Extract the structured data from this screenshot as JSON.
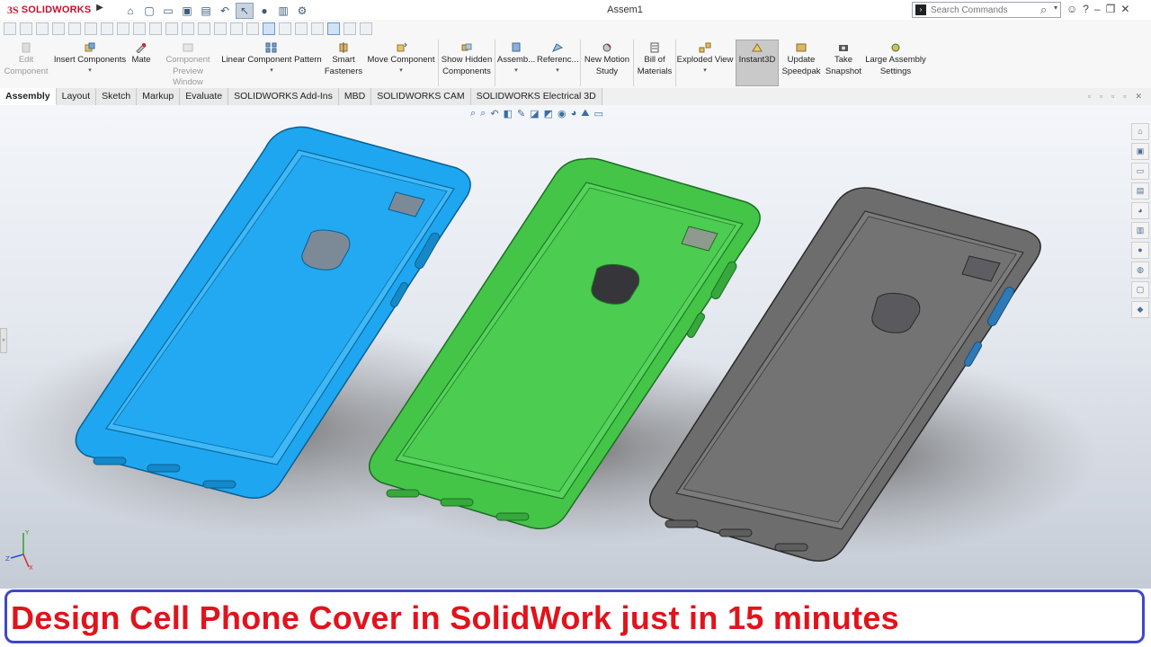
{
  "app": {
    "logo_mark": "3S",
    "logo_text": "SOLIDWORKS",
    "document_title": "Assem1"
  },
  "search": {
    "placeholder": "Search Commands"
  },
  "quick_access_icons": [
    "home-icon",
    "new-document-icon",
    "open-icon",
    "save-icon",
    "print-icon",
    "undo-icon",
    "select-icon",
    "rebuild-icon",
    "file-properties-icon",
    "options-icon"
  ],
  "command_manager": {
    "buttons": [
      {
        "label_1": "Edit",
        "label_2": "Component",
        "enabled": false
      },
      {
        "label_1": "Insert Components",
        "label_2": "",
        "dropdown": true
      },
      {
        "label_1": "Mate",
        "label_2": ""
      },
      {
        "label_1": "Component",
        "label_2": "Preview Window",
        "enabled": false
      },
      {
        "label_1": "Linear Component Pattern",
        "label_2": "",
        "dropdown": true
      },
      {
        "label_1": "Smart",
        "label_2": "Fasteners"
      },
      {
        "label_1": "Move Component",
        "label_2": "",
        "dropdown": true
      },
      {
        "label_1": "Show Hidden",
        "label_2": "Components"
      },
      {
        "label_1": "Assemb...",
        "label_2": "",
        "dropdown": true
      },
      {
        "label_1": "Referenc...",
        "label_2": "",
        "dropdown": true
      },
      {
        "label_1": "New Motion",
        "label_2": "Study"
      },
      {
        "label_1": "Bill of",
        "label_2": "Materials"
      },
      {
        "label_1": "Exploded View",
        "label_2": "",
        "dropdown": true
      },
      {
        "label_1": "Instant3D",
        "label_2": "",
        "active": true
      },
      {
        "label_1": "Update",
        "label_2": "Speedpak"
      },
      {
        "label_1": "Take",
        "label_2": "Snapshot"
      },
      {
        "label_1": "Large Assembly",
        "label_2": "Settings"
      }
    ]
  },
  "tabs": [
    "Assembly",
    "Layout",
    "Sketch",
    "Markup",
    "Evaluate",
    "SOLIDWORKS Add-Ins",
    "MBD",
    "SOLIDWORKS CAM",
    "SOLIDWORKS Electrical 3D"
  ],
  "active_tab": "Assembly",
  "viewport": {
    "models": [
      {
        "name": "blue-phone-cover",
        "color": "#1ea7f0"
      },
      {
        "name": "green-phone-cover",
        "color": "#44c548"
      },
      {
        "name": "gray-phone-cover",
        "color": "#6d6d6d"
      }
    ],
    "triad_axes": [
      "Y",
      "Z",
      "X"
    ]
  },
  "banner": {
    "text": "Design Cell Phone Cover in SolidWork just in 15 minutes",
    "text_color": "#e0141c",
    "border_color": "#3f47c8"
  }
}
